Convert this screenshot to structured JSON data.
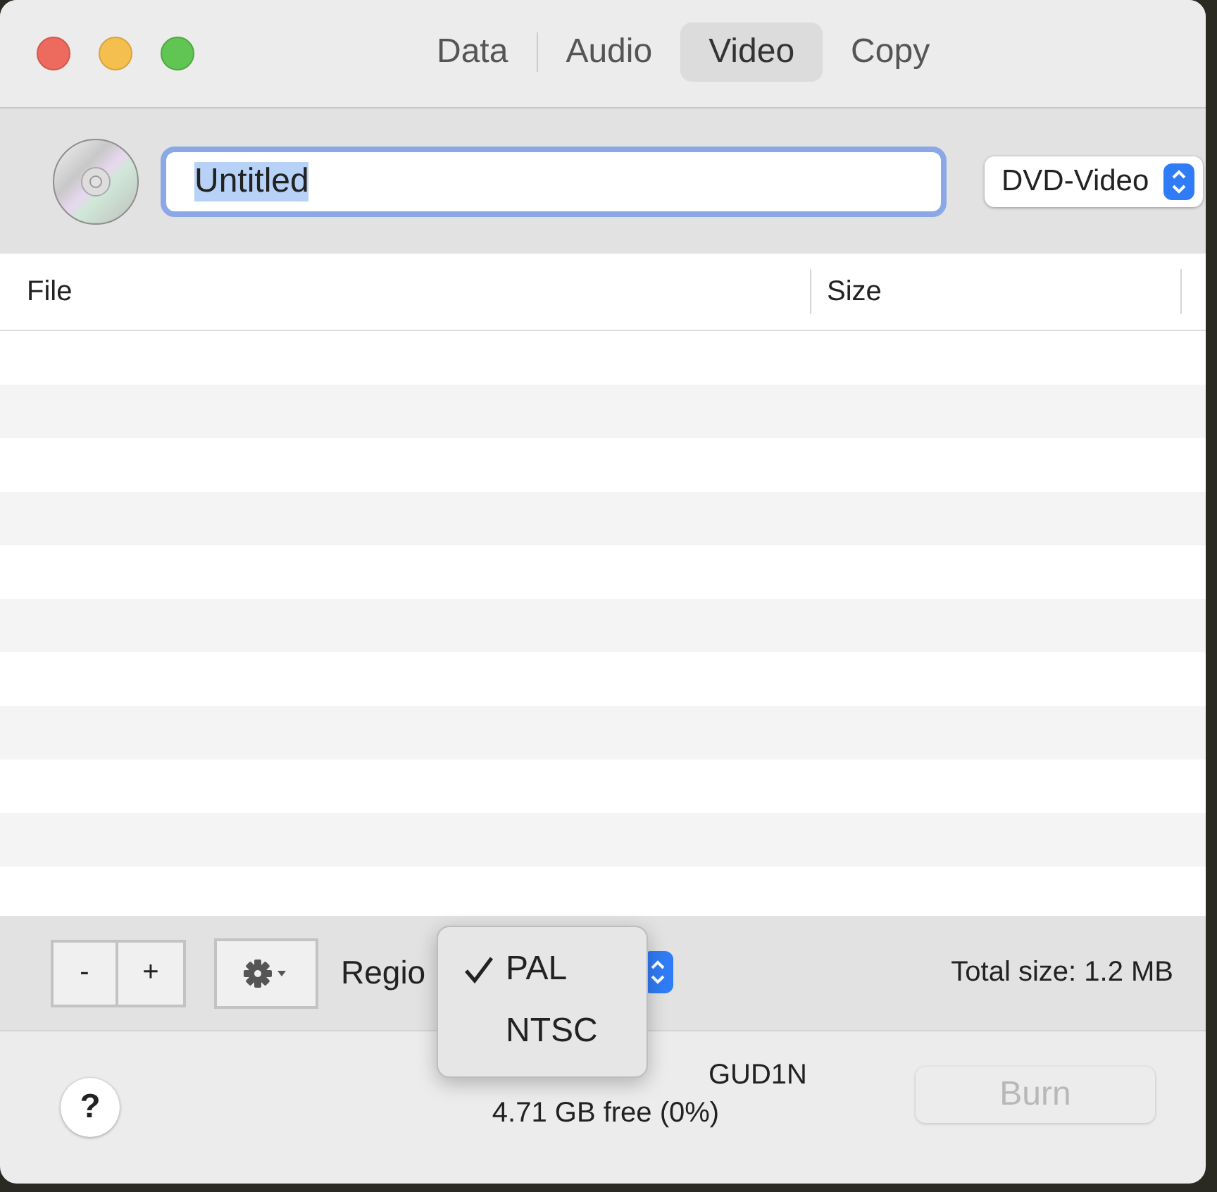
{
  "tabs": [
    {
      "label": "Data",
      "selected": false
    },
    {
      "label": "Audio",
      "selected": false
    },
    {
      "label": "Video",
      "selected": true
    },
    {
      "label": "Copy",
      "selected": false
    }
  ],
  "disc_name": {
    "value": "Untitled",
    "text_selected": true
  },
  "format_popup": {
    "value": "DVD-Video"
  },
  "table": {
    "columns": [
      "File",
      "Size"
    ]
  },
  "toolbar": {
    "remove_button": "-",
    "add_button": "+",
    "region_label": "Regio",
    "total_size": "Total size: 1.2 MB"
  },
  "region_menu": {
    "items": [
      {
        "label": "PAL",
        "selected": true
      },
      {
        "label": "NTSC",
        "selected": false
      }
    ]
  },
  "status": {
    "help_button": "?",
    "drive_name": "GUD1N",
    "drive_free": "4.71 GB free (0%)",
    "burn_button": {
      "label": "Burn",
      "disabled": true
    }
  }
}
